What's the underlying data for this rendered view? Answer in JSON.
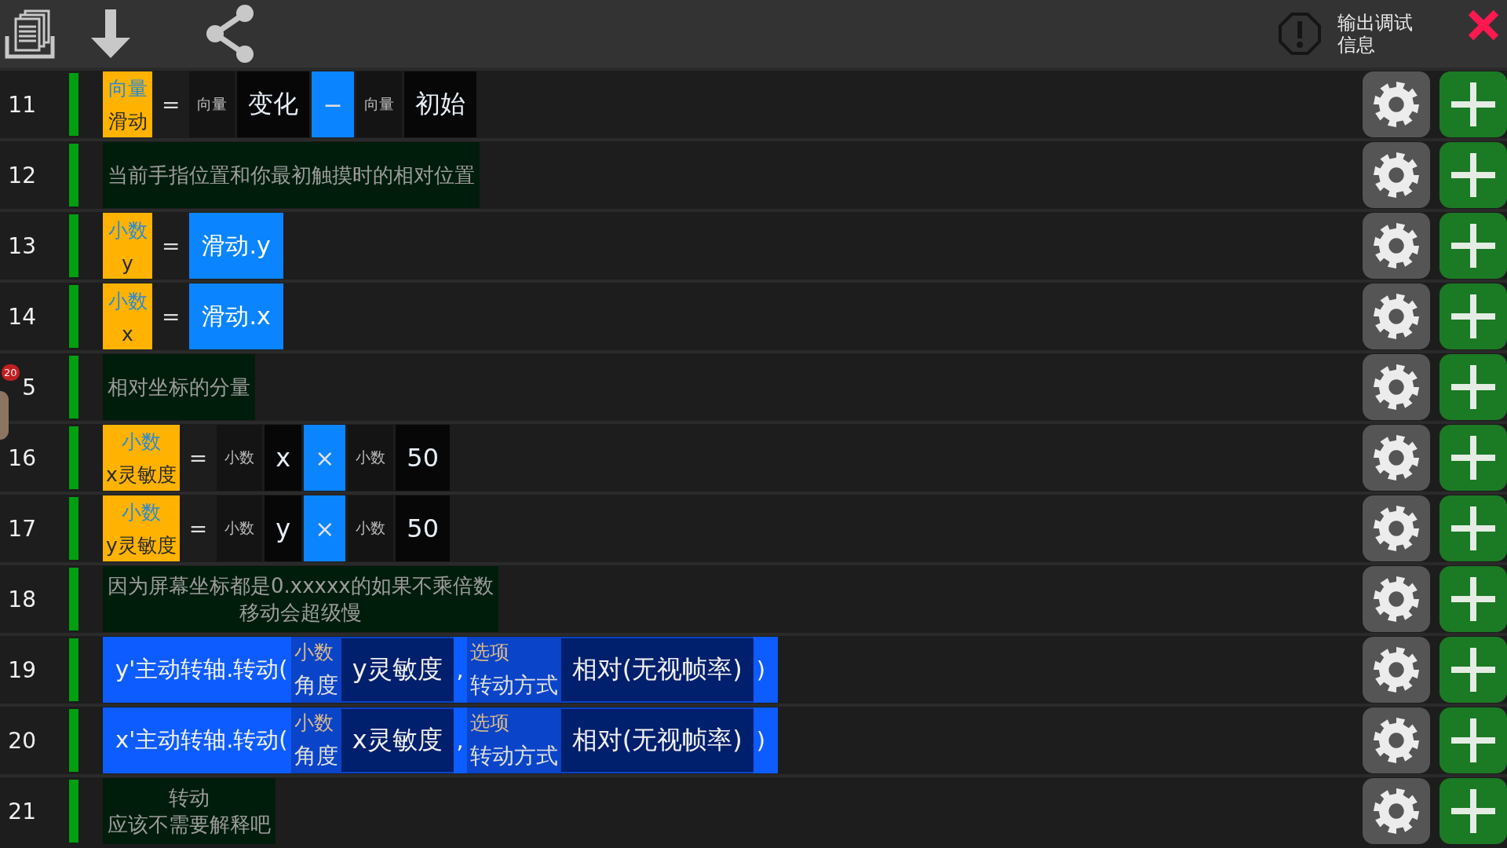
{
  "toolbar": {
    "debug_label": "输出调试信息"
  },
  "floating_widget": {
    "count": "20"
  },
  "rows": [
    {
      "number": "11",
      "kind": "statement",
      "parts": [
        {
          "kind": "var",
          "type": "向量",
          "name": "滑动"
        },
        {
          "kind": "eq",
          "text": "="
        },
        {
          "kind": "type",
          "text": "向量"
        },
        {
          "kind": "value",
          "text": "变化"
        },
        {
          "kind": "op",
          "text": "−"
        },
        {
          "kind": "type",
          "text": "向量"
        },
        {
          "kind": "value",
          "text": "初始"
        }
      ]
    },
    {
      "number": "12",
      "kind": "statement",
      "parts": [
        {
          "kind": "comment",
          "lines": [
            "当前手指位置和你最初触摸时的相对位置"
          ]
        }
      ]
    },
    {
      "number": "13",
      "kind": "statement",
      "parts": [
        {
          "kind": "var",
          "type": "小数",
          "name": "y"
        },
        {
          "kind": "eq",
          "text": "="
        },
        {
          "kind": "ref",
          "text": "滑动.y"
        }
      ]
    },
    {
      "number": "14",
      "kind": "statement",
      "parts": [
        {
          "kind": "var",
          "type": "小数",
          "name": "x"
        },
        {
          "kind": "eq",
          "text": "="
        },
        {
          "kind": "ref",
          "text": "滑动.x"
        }
      ]
    },
    {
      "number": "5",
      "kind": "statement",
      "parts": [
        {
          "kind": "comment",
          "lines": [
            "相对坐标的分量"
          ]
        }
      ]
    },
    {
      "number": "16",
      "kind": "statement",
      "parts": [
        {
          "kind": "var",
          "type": "小数",
          "name": "x灵敏度"
        },
        {
          "kind": "eq",
          "text": "="
        },
        {
          "kind": "type",
          "text": "小数"
        },
        {
          "kind": "value",
          "text": "x"
        },
        {
          "kind": "op",
          "text": "×"
        },
        {
          "kind": "type",
          "text": "小数"
        },
        {
          "kind": "value",
          "text": "50"
        }
      ]
    },
    {
      "number": "17",
      "kind": "statement",
      "parts": [
        {
          "kind": "var",
          "type": "小数",
          "name": "y灵敏度"
        },
        {
          "kind": "eq",
          "text": "="
        },
        {
          "kind": "type",
          "text": "小数"
        },
        {
          "kind": "value",
          "text": "y"
        },
        {
          "kind": "op",
          "text": "×"
        },
        {
          "kind": "type",
          "text": "小数"
        },
        {
          "kind": "value",
          "text": "50"
        }
      ]
    },
    {
      "number": "18",
      "kind": "statement",
      "parts": [
        {
          "kind": "comment",
          "lines": [
            "因为屏幕坐标都是0.xxxxx的如果不乘倍数",
            "移动会超级慢"
          ]
        }
      ]
    },
    {
      "number": "19",
      "kind": "call",
      "parts": [
        {
          "kind": "text",
          "text": "y'主动转轴.转动("
        },
        {
          "kind": "arg",
          "type": "小数",
          "name": "角度",
          "value": "y灵敏度"
        },
        {
          "kind": "text",
          "text": ","
        },
        {
          "kind": "arg",
          "type": "选项",
          "name": "转动方式",
          "value": "相对(无视帧率)"
        },
        {
          "kind": "text",
          "text": ")"
        }
      ]
    },
    {
      "number": "20",
      "kind": "call",
      "parts": [
        {
          "kind": "text",
          "text": "x'主动转轴.转动("
        },
        {
          "kind": "arg",
          "type": "小数",
          "name": "角度",
          "value": "x灵敏度"
        },
        {
          "kind": "text",
          "text": ","
        },
        {
          "kind": "arg",
          "type": "选项",
          "name": "转动方式",
          "value": "相对(无视帧率)"
        },
        {
          "kind": "text",
          "text": ")"
        }
      ]
    },
    {
      "number": "21",
      "kind": "statement",
      "parts": [
        {
          "kind": "comment",
          "lines": [
            "转动",
            "应该不需要解释吧"
          ]
        }
      ]
    }
  ]
}
